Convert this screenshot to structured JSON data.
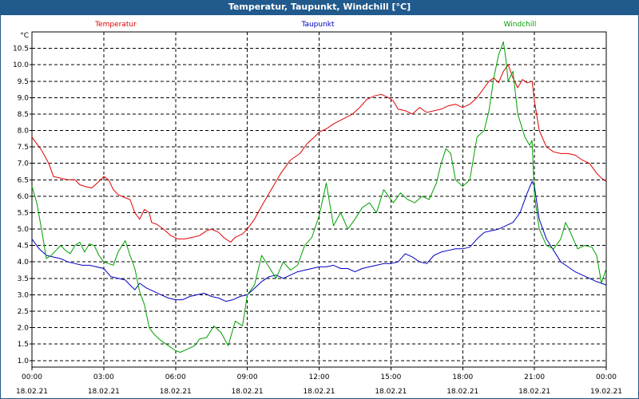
{
  "title": "Temperatur, Taupunkt, Windchill [°C]",
  "chart_data": {
    "type": "line",
    "title": "Temperatur, Taupunkt, Windchill [°C]",
    "ylabel": "°C",
    "ylim": [
      0.8,
      11.0
    ],
    "yticks": [
      "1.0",
      "1.5",
      "2.0",
      "2.5",
      "3.0",
      "3.5",
      "4.0",
      "4.5",
      "5.0",
      "5.5",
      "6.0",
      "6.5",
      "7.0",
      "7.5",
      "8.0",
      "8.5",
      "9.0",
      "9.5",
      "10.0",
      "10.5"
    ],
    "xlim": [
      0,
      24
    ],
    "xticks": [
      {
        "time": "00:00",
        "date": "18.02.21"
      },
      {
        "time": "03:00",
        "date": "18.02.21"
      },
      {
        "time": "06:00",
        "date": "18.02.21"
      },
      {
        "time": "09:00",
        "date": "18.02.21"
      },
      {
        "time": "12:00",
        "date": "18.02.21"
      },
      {
        "time": "15:00",
        "date": "18.02.21"
      },
      {
        "time": "18:00",
        "date": "18.02.21"
      },
      {
        "time": "21:00",
        "date": "18.02.21"
      },
      {
        "time": "00:00",
        "date": "19.02.21"
      }
    ],
    "grid": true,
    "legend_position": "top",
    "series": [
      {
        "name": "Temperatur",
        "color": "#e00000",
        "points": [
          [
            0,
            7.8
          ],
          [
            0.4,
            7.4
          ],
          [
            0.7,
            7.0
          ],
          [
            0.9,
            6.6
          ],
          [
            1.2,
            6.55
          ],
          [
            1.5,
            6.5
          ],
          [
            1.8,
            6.5
          ],
          [
            2.0,
            6.35
          ],
          [
            2.2,
            6.3
          ],
          [
            2.5,
            6.25
          ],
          [
            2.8,
            6.45
          ],
          [
            3.0,
            6.6
          ],
          [
            3.2,
            6.5
          ],
          [
            3.4,
            6.2
          ],
          [
            3.6,
            6.05
          ],
          [
            3.9,
            5.95
          ],
          [
            4.1,
            5.9
          ],
          [
            4.3,
            5.5
          ],
          [
            4.5,
            5.3
          ],
          [
            4.7,
            5.6
          ],
          [
            4.9,
            5.5
          ],
          [
            5.0,
            5.2
          ],
          [
            5.2,
            5.15
          ],
          [
            5.5,
            5.0
          ],
          [
            5.8,
            4.8
          ],
          [
            6.1,
            4.7
          ],
          [
            6.4,
            4.7
          ],
          [
            6.7,
            4.75
          ],
          [
            7.0,
            4.8
          ],
          [
            7.3,
            4.95
          ],
          [
            7.5,
            5.0
          ],
          [
            7.8,
            4.9
          ],
          [
            8.0,
            4.75
          ],
          [
            8.3,
            4.6
          ],
          [
            8.5,
            4.75
          ],
          [
            8.8,
            4.85
          ],
          [
            9.0,
            5.0
          ],
          [
            9.3,
            5.3
          ],
          [
            9.6,
            5.7
          ],
          [
            10.0,
            6.2
          ],
          [
            10.4,
            6.7
          ],
          [
            10.8,
            7.1
          ],
          [
            11.2,
            7.3
          ],
          [
            11.5,
            7.6
          ],
          [
            11.8,
            7.8
          ],
          [
            12.0,
            7.95
          ],
          [
            12.3,
            8.05
          ],
          [
            12.6,
            8.2
          ],
          [
            13.0,
            8.35
          ],
          [
            13.4,
            8.5
          ],
          [
            13.7,
            8.7
          ],
          [
            14.0,
            8.95
          ],
          [
            14.3,
            9.05
          ],
          [
            14.6,
            9.1
          ],
          [
            14.9,
            9.0
          ],
          [
            15.1,
            8.9
          ],
          [
            15.3,
            8.65
          ],
          [
            15.6,
            8.6
          ],
          [
            15.9,
            8.5
          ],
          [
            16.2,
            8.7
          ],
          [
            16.5,
            8.55
          ],
          [
            16.8,
            8.6
          ],
          [
            17.1,
            8.65
          ],
          [
            17.4,
            8.75
          ],
          [
            17.7,
            8.8
          ],
          [
            18.0,
            8.7
          ],
          [
            18.3,
            8.8
          ],
          [
            18.6,
            9.0
          ],
          [
            18.9,
            9.3
          ],
          [
            19.1,
            9.5
          ],
          [
            19.3,
            9.6
          ],
          [
            19.5,
            9.45
          ],
          [
            19.7,
            9.8
          ],
          [
            19.9,
            10.0
          ],
          [
            20.1,
            9.6
          ],
          [
            20.3,
            9.3
          ],
          [
            20.5,
            9.55
          ],
          [
            20.7,
            9.45
          ],
          [
            20.9,
            9.5
          ],
          [
            21.0,
            8.9
          ],
          [
            21.2,
            8.0
          ],
          [
            21.5,
            7.5
          ],
          [
            21.8,
            7.35
          ],
          [
            22.1,
            7.3
          ],
          [
            22.4,
            7.3
          ],
          [
            22.7,
            7.25
          ],
          [
            23.0,
            7.1
          ],
          [
            23.3,
            7.0
          ],
          [
            23.6,
            6.7
          ],
          [
            23.8,
            6.55
          ],
          [
            24.0,
            6.45
          ]
        ]
      },
      {
        "name": "Taupunkt",
        "color": "#0000c0",
        "points": [
          [
            0,
            4.7
          ],
          [
            0.3,
            4.4
          ],
          [
            0.6,
            4.2
          ],
          [
            0.9,
            4.15
          ],
          [
            1.2,
            4.1
          ],
          [
            1.5,
            4.0
          ],
          [
            1.8,
            3.95
          ],
          [
            2.1,
            3.9
          ],
          [
            2.4,
            3.9
          ],
          [
            2.7,
            3.85
          ],
          [
            3.0,
            3.8
          ],
          [
            3.3,
            3.55
          ],
          [
            3.6,
            3.5
          ],
          [
            3.9,
            3.45
          ],
          [
            4.1,
            3.3
          ],
          [
            4.3,
            3.15
          ],
          [
            4.5,
            3.35
          ],
          [
            4.8,
            3.2
          ],
          [
            5.1,
            3.1
          ],
          [
            5.4,
            3.0
          ],
          [
            5.7,
            2.9
          ],
          [
            6.0,
            2.85
          ],
          [
            6.3,
            2.85
          ],
          [
            6.6,
            2.95
          ],
          [
            6.9,
            3.0
          ],
          [
            7.2,
            3.05
          ],
          [
            7.5,
            2.95
          ],
          [
            7.8,
            2.9
          ],
          [
            8.1,
            2.8
          ],
          [
            8.4,
            2.85
          ],
          [
            8.7,
            2.95
          ],
          [
            9.0,
            3.0
          ],
          [
            9.3,
            3.2
          ],
          [
            9.6,
            3.4
          ],
          [
            9.9,
            3.55
          ],
          [
            10.2,
            3.6
          ],
          [
            10.5,
            3.5
          ],
          [
            10.8,
            3.6
          ],
          [
            11.1,
            3.7
          ],
          [
            11.4,
            3.75
          ],
          [
            11.7,
            3.8
          ],
          [
            12.0,
            3.85
          ],
          [
            12.3,
            3.85
          ],
          [
            12.6,
            3.9
          ],
          [
            12.9,
            3.8
          ],
          [
            13.2,
            3.8
          ],
          [
            13.5,
            3.7
          ],
          [
            13.8,
            3.8
          ],
          [
            14.1,
            3.85
          ],
          [
            14.4,
            3.9
          ],
          [
            14.7,
            3.95
          ],
          [
            15.0,
            3.95
          ],
          [
            15.3,
            4.0
          ],
          [
            15.6,
            4.25
          ],
          [
            15.9,
            4.15
          ],
          [
            16.2,
            4.0
          ],
          [
            16.5,
            3.95
          ],
          [
            16.8,
            4.2
          ],
          [
            17.1,
            4.3
          ],
          [
            17.4,
            4.35
          ],
          [
            17.7,
            4.4
          ],
          [
            18.0,
            4.4
          ],
          [
            18.3,
            4.45
          ],
          [
            18.6,
            4.7
          ],
          [
            18.9,
            4.9
          ],
          [
            19.2,
            4.95
          ],
          [
            19.5,
            5.0
          ],
          [
            19.8,
            5.1
          ],
          [
            20.1,
            5.2
          ],
          [
            20.4,
            5.5
          ],
          [
            20.7,
            6.1
          ],
          [
            20.9,
            6.45
          ],
          [
            21.0,
            6.3
          ],
          [
            21.2,
            5.3
          ],
          [
            21.5,
            4.7
          ],
          [
            21.8,
            4.35
          ],
          [
            22.1,
            4.0
          ],
          [
            22.4,
            3.85
          ],
          [
            22.7,
            3.7
          ],
          [
            23.0,
            3.6
          ],
          [
            23.3,
            3.5
          ],
          [
            23.6,
            3.4
          ],
          [
            24.0,
            3.3
          ]
        ]
      },
      {
        "name": "Windchill",
        "color": "#00a000",
        "points": [
          [
            0,
            6.3
          ],
          [
            0.2,
            5.8
          ],
          [
            0.4,
            5.0
          ],
          [
            0.6,
            4.1
          ],
          [
            0.8,
            4.2
          ],
          [
            1.0,
            4.35
          ],
          [
            1.2,
            4.5
          ],
          [
            1.4,
            4.35
          ],
          [
            1.6,
            4.25
          ],
          [
            1.8,
            4.5
          ],
          [
            2.0,
            4.6
          ],
          [
            2.2,
            4.3
          ],
          [
            2.4,
            4.55
          ],
          [
            2.6,
            4.5
          ],
          [
            2.8,
            4.2
          ],
          [
            3.0,
            4.0
          ],
          [
            3.2,
            3.95
          ],
          [
            3.4,
            3.9
          ],
          [
            3.6,
            4.3
          ],
          [
            3.9,
            4.65
          ],
          [
            4.1,
            4.2
          ],
          [
            4.3,
            3.8
          ],
          [
            4.5,
            3.1
          ],
          [
            4.7,
            2.7
          ],
          [
            4.9,
            2.0
          ],
          [
            5.1,
            1.8
          ],
          [
            5.4,
            1.6
          ],
          [
            5.7,
            1.45
          ],
          [
            6.0,
            1.3
          ],
          [
            6.2,
            1.25
          ],
          [
            6.5,
            1.35
          ],
          [
            6.8,
            1.45
          ],
          [
            7.0,
            1.65
          ],
          [
            7.3,
            1.7
          ],
          [
            7.6,
            2.05
          ],
          [
            7.9,
            1.85
          ],
          [
            8.2,
            1.45
          ],
          [
            8.5,
            2.2
          ],
          [
            8.8,
            2.05
          ],
          [
            9.0,
            3.0
          ],
          [
            9.3,
            3.3
          ],
          [
            9.6,
            4.2
          ],
          [
            9.9,
            3.85
          ],
          [
            10.2,
            3.5
          ],
          [
            10.5,
            4.0
          ],
          [
            10.8,
            3.75
          ],
          [
            11.1,
            3.9
          ],
          [
            11.4,
            4.5
          ],
          [
            11.7,
            4.75
          ],
          [
            12.0,
            5.4
          ],
          [
            12.3,
            6.4
          ],
          [
            12.6,
            5.1
          ],
          [
            12.9,
            5.5
          ],
          [
            13.2,
            5.0
          ],
          [
            13.5,
            5.3
          ],
          [
            13.8,
            5.65
          ],
          [
            14.1,
            5.8
          ],
          [
            14.4,
            5.5
          ],
          [
            14.7,
            6.2
          ],
          [
            14.9,
            6.0
          ],
          [
            15.1,
            5.8
          ],
          [
            15.4,
            6.1
          ],
          [
            15.7,
            5.9
          ],
          [
            16.0,
            5.8
          ],
          [
            16.3,
            6.0
          ],
          [
            16.6,
            5.9
          ],
          [
            16.9,
            6.4
          ],
          [
            17.1,
            7.0
          ],
          [
            17.3,
            7.45
          ],
          [
            17.5,
            7.3
          ],
          [
            17.7,
            6.5
          ],
          [
            18.0,
            6.3
          ],
          [
            18.3,
            6.5
          ],
          [
            18.6,
            7.8
          ],
          [
            18.9,
            8.0
          ],
          [
            19.1,
            8.6
          ],
          [
            19.3,
            9.6
          ],
          [
            19.5,
            10.3
          ],
          [
            19.7,
            10.7
          ],
          [
            19.8,
            10.2
          ],
          [
            19.9,
            9.5
          ],
          [
            20.1,
            9.8
          ],
          [
            20.3,
            8.5
          ],
          [
            20.6,
            7.8
          ],
          [
            20.8,
            7.55
          ],
          [
            20.9,
            7.7
          ],
          [
            21.0,
            6.0
          ],
          [
            21.2,
            5.0
          ],
          [
            21.5,
            4.5
          ],
          [
            21.8,
            4.4
          ],
          [
            22.1,
            4.7
          ],
          [
            22.3,
            5.2
          ],
          [
            22.5,
            4.9
          ],
          [
            22.8,
            4.4
          ],
          [
            23.1,
            4.5
          ],
          [
            23.4,
            4.45
          ],
          [
            23.6,
            4.2
          ],
          [
            23.8,
            3.35
          ],
          [
            24.0,
            3.8
          ]
        ]
      }
    ]
  }
}
